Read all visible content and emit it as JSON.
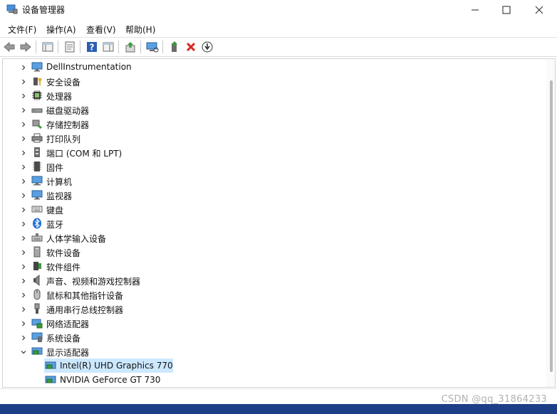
{
  "window": {
    "title": "设备管理器",
    "controls": [
      "minimize",
      "maximize",
      "close"
    ]
  },
  "menu": [
    "文件(F)",
    "操作(A)",
    "查看(V)",
    "帮助(H)"
  ],
  "toolbar": {
    "buttons": [
      "back-arrow-icon",
      "forward-arrow-icon",
      "show-hide-tree-icon",
      "properties-icon",
      "help-icon",
      "action-pane-icon",
      "update-driver-icon",
      "scan-hardware-icon",
      "add-driver-icon",
      "uninstall-icon",
      "download-icon"
    ]
  },
  "tree": {
    "items": [
      {
        "label": "DellInstrumentation",
        "icon": "monitor-icon",
        "expanded": false
      },
      {
        "label": "安全设备",
        "icon": "security-device-icon",
        "expanded": false
      },
      {
        "label": "处理器",
        "icon": "processor-icon",
        "expanded": false
      },
      {
        "label": "磁盘驱动器",
        "icon": "disk-drive-icon",
        "expanded": false
      },
      {
        "label": "存储控制器",
        "icon": "storage-controller-icon",
        "expanded": false
      },
      {
        "label": "打印队列",
        "icon": "printer-icon",
        "expanded": false
      },
      {
        "label": "端口 (COM 和 LPT)",
        "icon": "port-icon",
        "expanded": false
      },
      {
        "label": "固件",
        "icon": "firmware-icon",
        "expanded": false
      },
      {
        "label": "计算机",
        "icon": "computer-icon",
        "expanded": false
      },
      {
        "label": "监视器",
        "icon": "monitor-icon",
        "expanded": false
      },
      {
        "label": "键盘",
        "icon": "keyboard-icon",
        "expanded": false
      },
      {
        "label": "蓝牙",
        "icon": "bluetooth-icon",
        "expanded": false
      },
      {
        "label": "人体学输入设备",
        "icon": "hid-icon",
        "expanded": false
      },
      {
        "label": "软件设备",
        "icon": "software-device-icon",
        "expanded": false
      },
      {
        "label": "软件组件",
        "icon": "software-component-icon",
        "expanded": false
      },
      {
        "label": "声音、视频和游戏控制器",
        "icon": "speaker-icon",
        "expanded": false
      },
      {
        "label": "鼠标和其他指针设备",
        "icon": "mouse-icon",
        "expanded": false
      },
      {
        "label": "通用串行总线控制器",
        "icon": "usb-icon",
        "expanded": false
      },
      {
        "label": "网络适配器",
        "icon": "network-adapter-icon",
        "expanded": false
      },
      {
        "label": "系统设备",
        "icon": "system-device-icon",
        "expanded": false
      },
      {
        "label": "显示适配器",
        "icon": "display-adapter-icon",
        "expanded": true
      }
    ],
    "children": [
      {
        "label": "Intel(R) UHD Graphics 770",
        "icon": "display-adapter-icon",
        "selected": true
      },
      {
        "label": "NVIDIA GeForce GT 730",
        "icon": "display-adapter-icon",
        "selected": false
      }
    ]
  },
  "status": {
    "watermark": "CSDN @qq_31864233"
  },
  "colors": {
    "selection": "#cce8ff",
    "taskbar": "#1d3f87",
    "close_red": "#d9261c",
    "help_blue": "#2b5fb4"
  }
}
